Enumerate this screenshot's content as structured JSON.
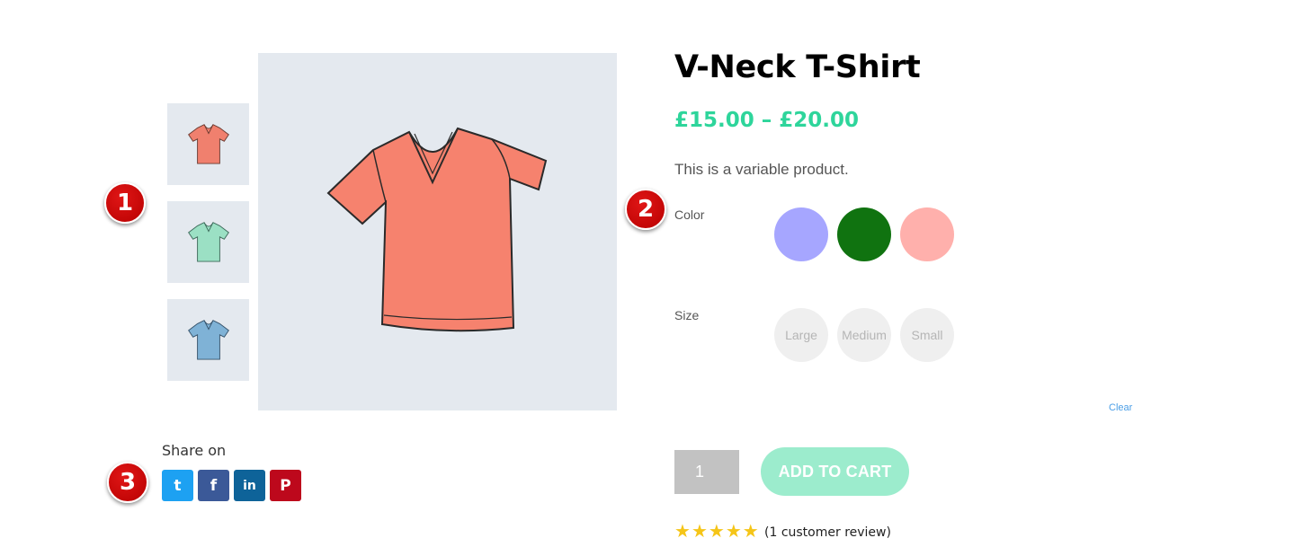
{
  "product": {
    "title": "V-Neck T-Shirt",
    "price_range": "£15.00 – £20.00",
    "description": "This is a variable product."
  },
  "gallery": {
    "thumbnails": [
      {
        "color_name": "coral",
        "color": "#f0806e"
      },
      {
        "color_name": "mint",
        "color": "#9be0c4"
      },
      {
        "color_name": "blue",
        "color": "#7fb2d6"
      }
    ],
    "main_color": "#f6826e"
  },
  "markers": [
    "1",
    "2",
    "3"
  ],
  "share": {
    "label": "Share on",
    "buttons": [
      {
        "network": "twitter",
        "glyph": "t",
        "color": "#1da1f2"
      },
      {
        "network": "facebook",
        "glyph": "f",
        "color": "#3b5998"
      },
      {
        "network": "linkedin",
        "glyph": "in",
        "color": "#0e6399"
      },
      {
        "network": "pinterest",
        "glyph": "P",
        "color": "#bd081c"
      }
    ]
  },
  "attributes": {
    "color_label": "Color",
    "colors": [
      "#a6a6ff",
      "#107310",
      "#ffb0ac"
    ],
    "size_label": "Size",
    "sizes": [
      "Large",
      "Medium",
      "Small"
    ],
    "clear_label": "Clear"
  },
  "cart": {
    "quantity": "1",
    "add_to_cart_label": "ADD TO CART"
  },
  "rating": {
    "stars": 5,
    "review_text": "(1 customer review)",
    "star_color": "#f5c518"
  },
  "colors": {
    "accent": "#2ed59b",
    "image_bg": "#e4e9ef"
  }
}
